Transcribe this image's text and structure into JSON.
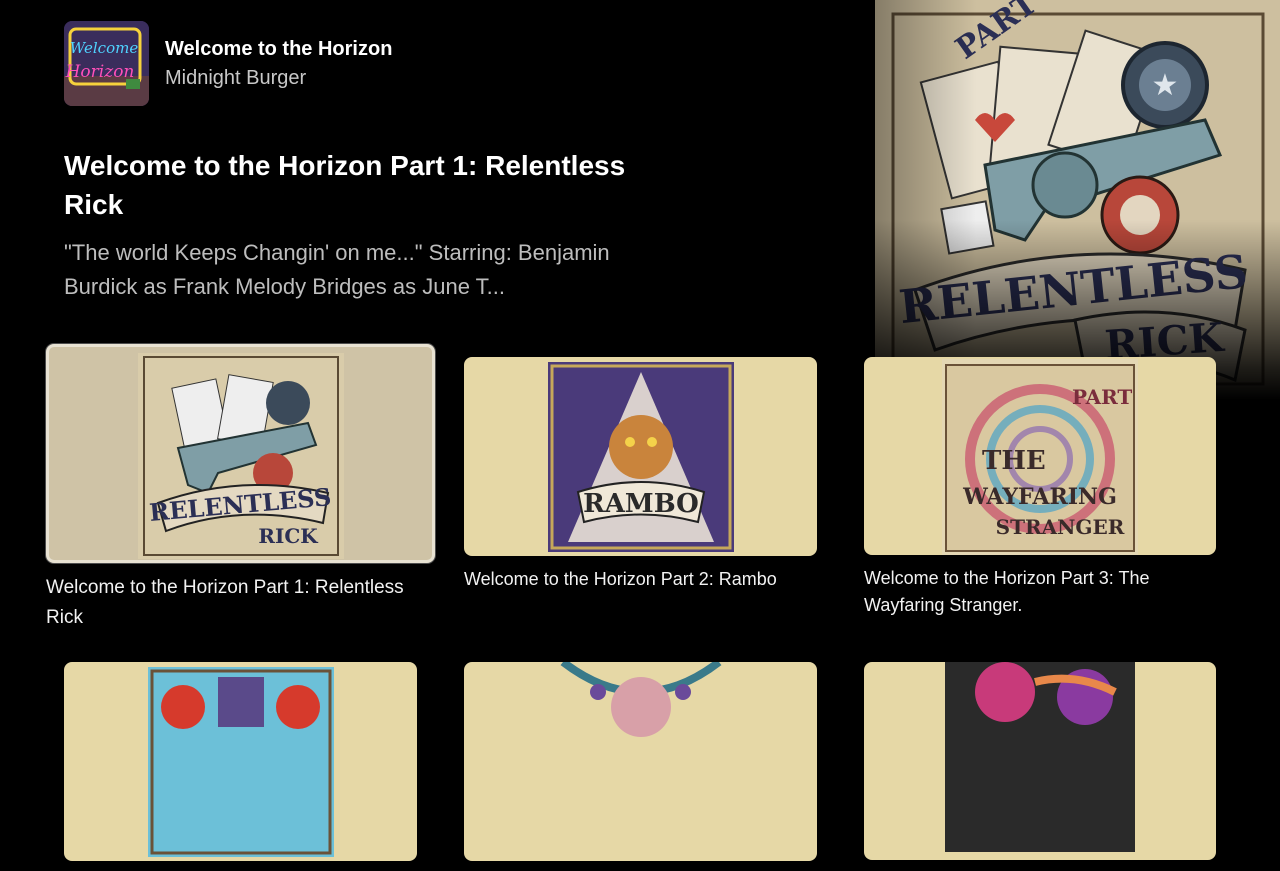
{
  "show": {
    "title": "Welcome to the Horizon",
    "creator": "Midnight Burger"
  },
  "episode": {
    "title": "Welcome to the Horizon Part 1: Relentless Rick",
    "description": "\"The world Keeps Changin' on me...\"  Starring: Benjamin Burdick as Frank Melody Bridges as June T..."
  },
  "episodes": [
    {
      "label": "Welcome to the Horizon Part 1: Relentless Rick",
      "art": "relentless-rick-art"
    },
    {
      "label": "Welcome to the Horizon Part 2: Rambo",
      "art": "rambo-art"
    },
    {
      "label": "Welcome to the Horizon Part 3: The Wayfaring Stranger.",
      "art": "wayfaring-stranger-art"
    },
    {
      "label": "",
      "art": "part-4-art"
    },
    {
      "label": "",
      "art": "part-5-art"
    },
    {
      "label": "",
      "art": "part-6-art"
    }
  ],
  "colors": {
    "background": "#000000",
    "card_background": "#e6d8a6",
    "focus_border": "#e8e2d2",
    "secondary_text": "#bdbdbd"
  }
}
